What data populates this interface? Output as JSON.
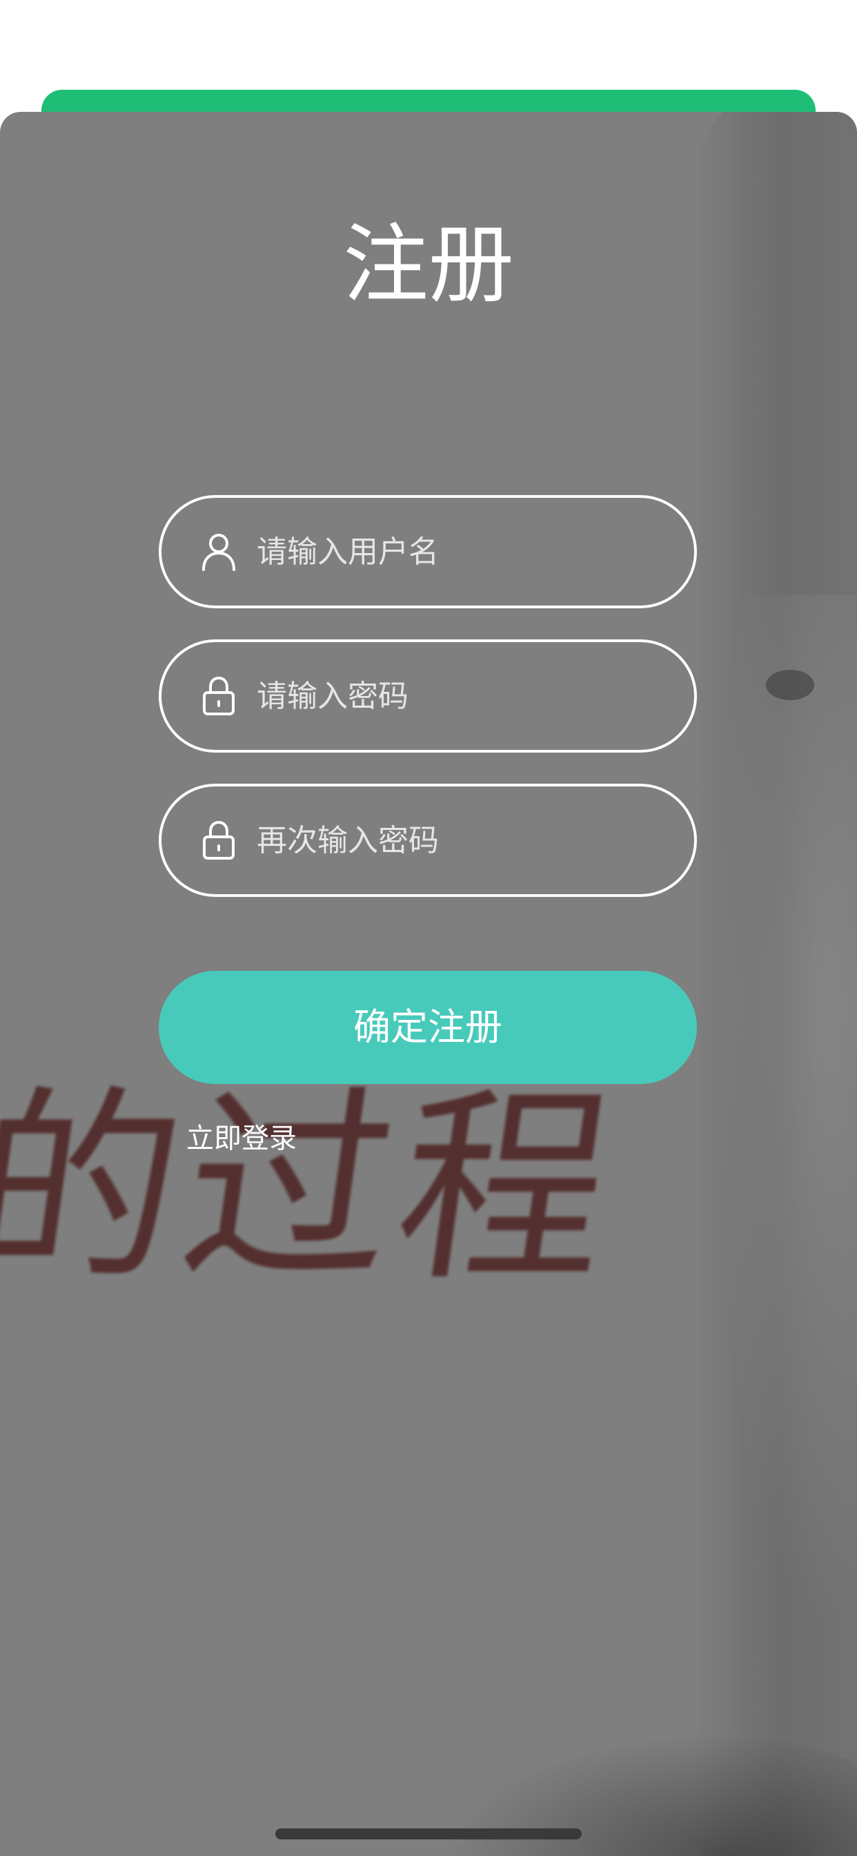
{
  "page": {
    "title": "注册",
    "accent_color": "#1fbe76",
    "button_color": "#48cabb"
  },
  "form": {
    "username": {
      "placeholder": "请输入用户名",
      "value": "",
      "icon": "user-icon"
    },
    "password": {
      "placeholder": "请输入密码",
      "value": "",
      "icon": "lock-icon"
    },
    "confirm_password": {
      "placeholder": "再次输入密码",
      "value": "",
      "icon": "lock-icon"
    },
    "submit_label": "确定注册",
    "login_link_label": "立即登录"
  },
  "background": {
    "calligraphy_text": "的过程"
  }
}
